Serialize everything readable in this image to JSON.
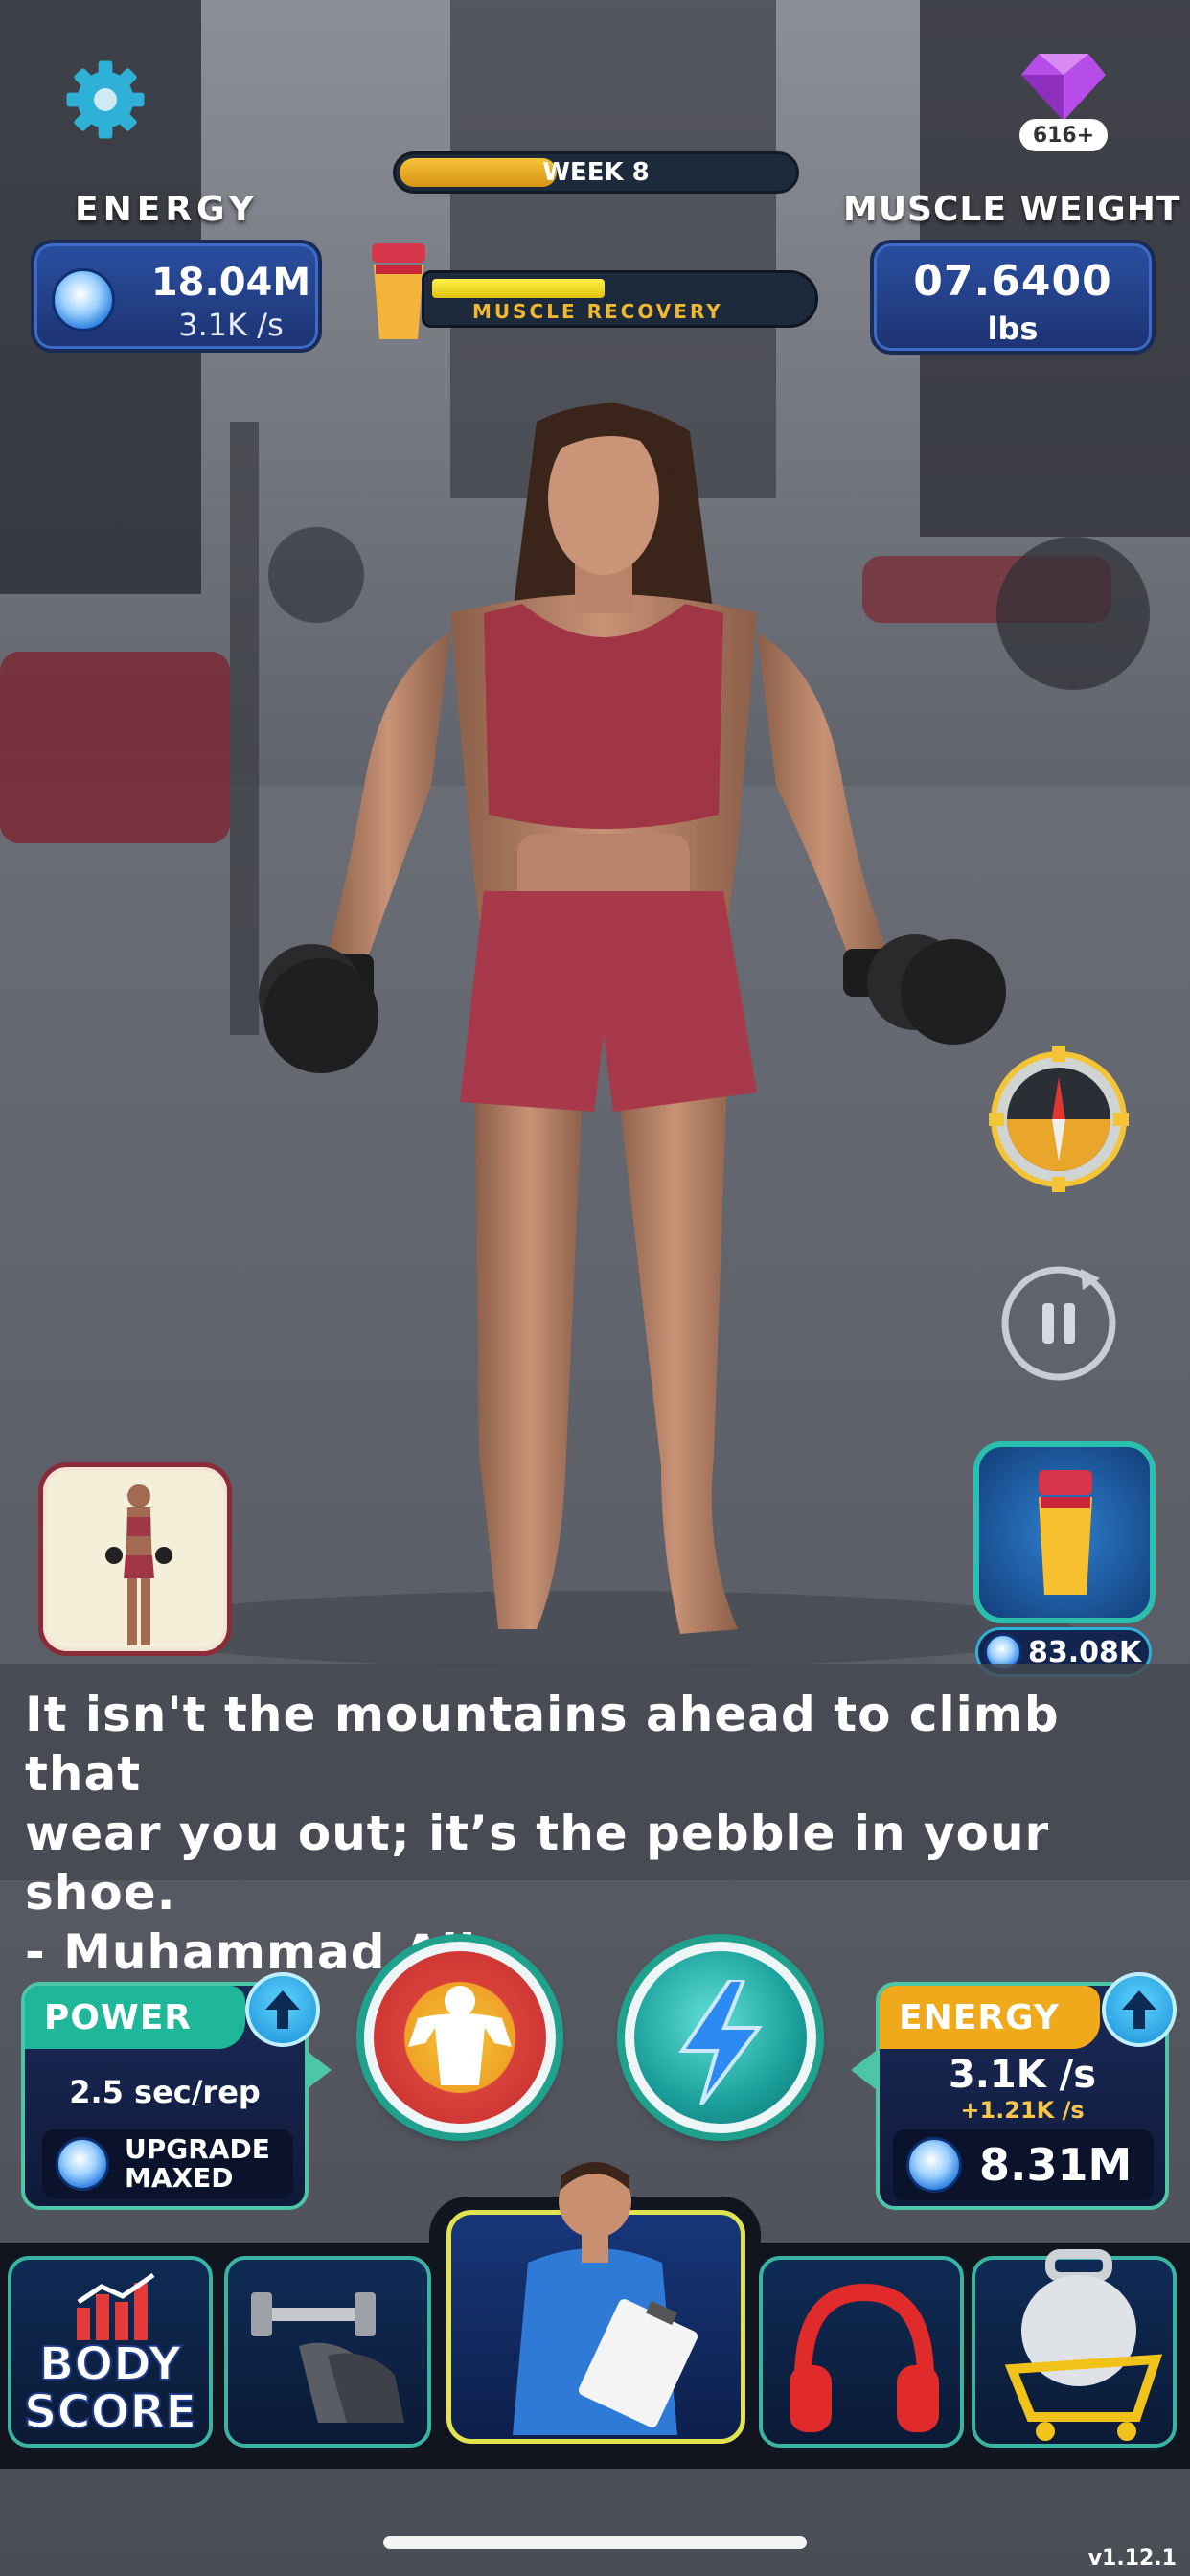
{
  "hud": {
    "energy_label": "ENERGY",
    "energy_value": "18.04M",
    "energy_rate": "3.1K /s",
    "muscle_weight_label": "MUSCLE WEIGHT",
    "muscle_weight_value": "07.6400",
    "muscle_weight_unit": "lbs",
    "gems_count": "616+",
    "week_label": "WEEK 8",
    "week_progress": 0.4,
    "recovery_label": "MUSCLE RECOVERY",
    "recovery_progress": 0.46
  },
  "shake_cost": "83.08K",
  "quote": {
    "line1": "It isn't the mountains ahead to climb that",
    "line2": "wear you out; it’s the pebble in your shoe.",
    "line3": "- Muhammad Ali"
  },
  "power_panel": {
    "title": "POWER",
    "rate": "2.5 sec/rep",
    "upgrade_line1": "UPGRADE",
    "upgrade_line2": "MAXED"
  },
  "energy_panel": {
    "title": "ENERGY",
    "rate": "3.1K /s",
    "bonus": "+1.21K /s",
    "cost": "8.31M"
  },
  "nav": {
    "body_score_line1": "BODY",
    "body_score_line2": "SCORE"
  },
  "version": "v1.12.1",
  "colors": {
    "accent_teal": "#3ab4a2",
    "power_head": "#1fb79a",
    "energy_head": "#f0a91a",
    "gem": "#b64de8"
  }
}
